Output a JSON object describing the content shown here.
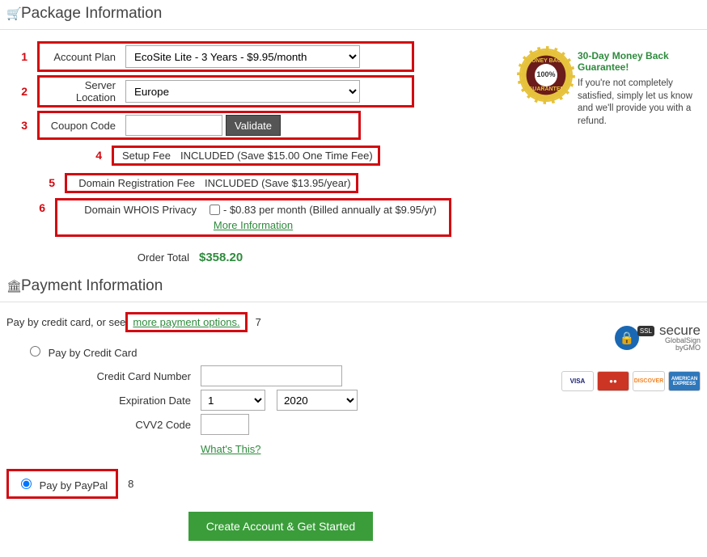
{
  "package_section_title": "Package Information",
  "payment_section_title": "Payment Information",
  "annotations": {
    "n1": "1",
    "n2": "2",
    "n3": "3",
    "n4": "4",
    "n5": "5",
    "n6": "6",
    "n7": "7",
    "n8": "8"
  },
  "form": {
    "account_plan_label": "Account Plan",
    "account_plan_value": "EcoSite Lite - 3 Years - $9.95/month",
    "server_location_label": "Server Location",
    "server_location_value": "Europe",
    "coupon_label": "Coupon Code",
    "validate_btn": "Validate",
    "setup_fee_label": "Setup Fee",
    "setup_fee_value": "INCLUDED (Save $15.00 One Time Fee)",
    "domain_reg_label": "Domain Registration Fee",
    "domain_reg_value": "INCLUDED (Save $13.95/year)",
    "whois_label": "Domain WHOIS Privacy",
    "whois_value": " - $0.83 per month (Billed annually at $9.95/yr)",
    "whois_more": "More Information",
    "order_total_label": "Order Total",
    "order_total_value": "$358.20"
  },
  "guarantee": {
    "title": "30-Day Money Back Guarantee!",
    "body": "If you're not completely satisfied, simply let us know and we'll provide you with a refund.",
    "seal_top": "MONEY BACK",
    "seal_pct": "100%",
    "seal_bot": "GUARANTEE"
  },
  "payment": {
    "intro_prefix": "Pay by credit card, or see ",
    "intro_link": "more payment options.",
    "pay_cc_label": "Pay by Credit Card",
    "cc_number_label": "Credit Card Number",
    "exp_label": "Expiration Date",
    "exp_month": "1",
    "exp_year": "2020",
    "cvv_label": "CVV2 Code",
    "whats_this": "What's This?",
    "pay_paypal_label": "Pay by PayPal",
    "submit_btn": "Create Account & Get Started"
  },
  "secure": {
    "word": "secure",
    "sub": "GlobalSign",
    "sub2": "byGMO",
    "ssl": "SSL"
  },
  "cards": {
    "visa": "VISA",
    "mc": "MasterCard",
    "disc": "DISCOVER",
    "amex": "AMERICAN EXPRESS"
  }
}
